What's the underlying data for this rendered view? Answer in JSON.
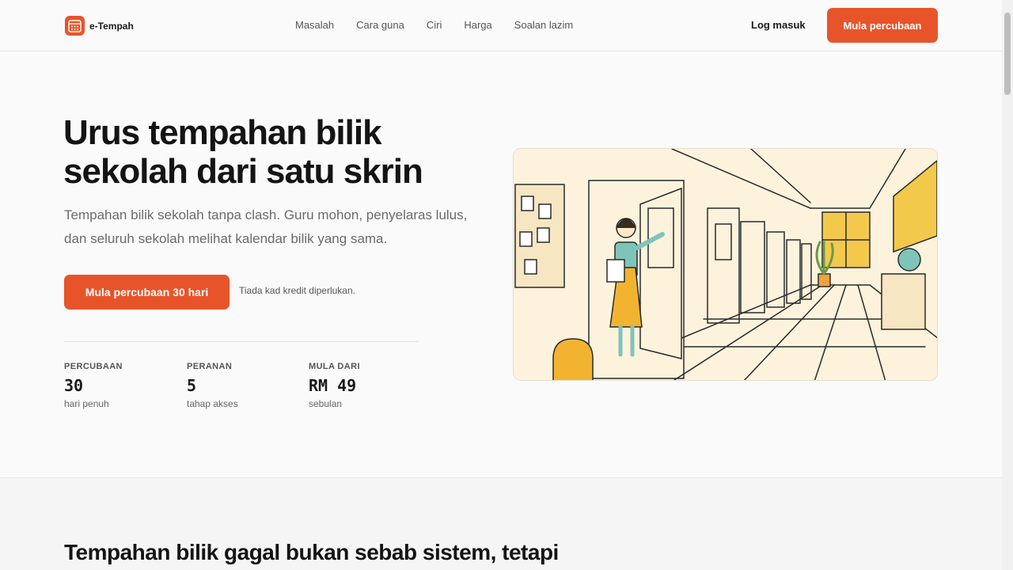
{
  "brand": {
    "name": "e-Tempah",
    "icon": "calendar-icon",
    "accent": "#e8542a"
  },
  "nav": {
    "items": [
      {
        "label": "Masalah"
      },
      {
        "label": "Cara guna"
      },
      {
        "label": "Ciri"
      },
      {
        "label": "Harga"
      },
      {
        "label": "Soalan lazim"
      }
    ],
    "login_label": "Log masuk",
    "cta_label": "Mula percubaan"
  },
  "hero": {
    "title": "Urus tempahan bilik sekolah dari satu skrin",
    "subtitle": "Tempahan bilik sekolah tanpa clash. Guru mohon, penyelaras lulus, dan seluruh sekolah melihat kalendar bilik yang sama.",
    "cta_label": "Mula percubaan 30 hari",
    "note": "Tiada kad kredit diperlukan.",
    "stats": [
      {
        "label": "PERCUBAAN",
        "value": "30",
        "caption": "hari penuh"
      },
      {
        "label": "PERANAN",
        "value": "5",
        "caption": "tahap akses"
      },
      {
        "label": "MULA DARI",
        "value": "RM 49",
        "caption": "sebulan"
      }
    ],
    "illustration": "teacher-in-school-corridor-illustration"
  },
  "section2": {
    "title": "Tempahan bilik gagal bukan sebab sistem, tetapi"
  }
}
